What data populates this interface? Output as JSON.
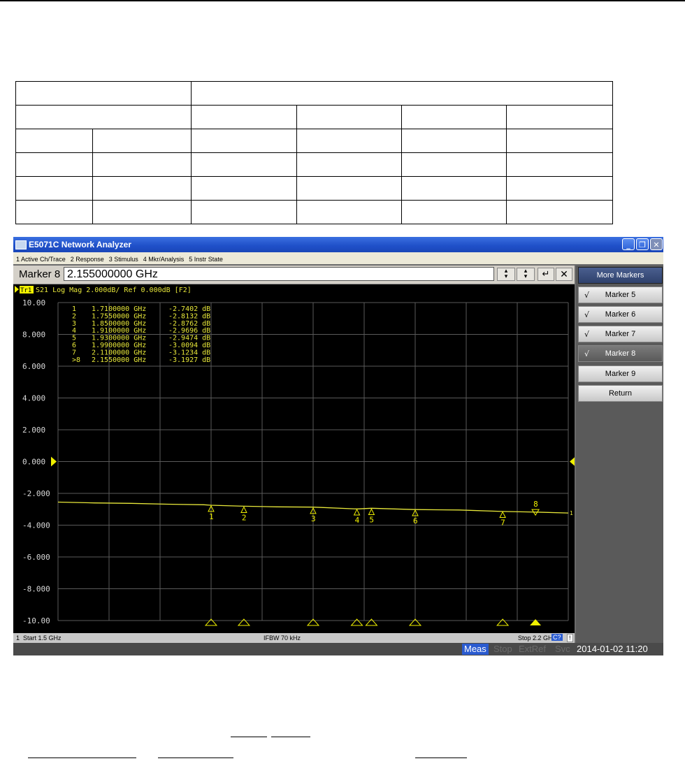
{
  "window": {
    "title": "E5071C Network Analyzer",
    "minimize_label": "_",
    "restore_label": "❐",
    "close_label": "✕"
  },
  "menu": [
    "1 Active Ch/Trace",
    "2 Response",
    "3 Stimulus",
    "4 Mkr/Analysis",
    "5 Instr State"
  ],
  "entry": {
    "label": "Marker 8",
    "value": "2.155000000 GHz"
  },
  "trace": {
    "header": "S21 Log Mag 2.000dB/ Ref 0.000dB [F2]",
    "tag": "Tr1",
    "ref_end_marker": "1"
  },
  "y_ticks": [
    "10.00",
    "8.000",
    "6.000",
    "4.000",
    "2.000",
    "0.000",
    "-2.000",
    "-4.000",
    "-6.000",
    "-8.000",
    "-10.00"
  ],
  "marker_table": [
    {
      "id": "1",
      "freq": "1.7100000 GHz",
      "val": "-2.7402 dB"
    },
    {
      "id": "2",
      "freq": "1.7550000 GHz",
      "val": "-2.8132 dB"
    },
    {
      "id": "3",
      "freq": "1.8500000 GHz",
      "val": "-2.8762 dB"
    },
    {
      "id": "4",
      "freq": "1.9100000 GHz",
      "val": "-2.9696 dB"
    },
    {
      "id": "5",
      "freq": "1.9300000 GHz",
      "val": "-2.9474 dB"
    },
    {
      "id": "6",
      "freq": "1.9900000 GHz",
      "val": "-3.0094 dB"
    },
    {
      "id": "7",
      "freq": "2.1100000 GHz",
      "val": "-3.1234 dB"
    },
    {
      "id": ">8",
      "freq": "2.1550000 GHz",
      "val": "-3.1927 dB"
    }
  ],
  "chart_data": {
    "type": "line",
    "x_unit": "GHz",
    "xlim": [
      1.5,
      2.2
    ],
    "ylim": [
      -10,
      10
    ],
    "y_div": 2,
    "grid": true,
    "series": [
      {
        "x": [
          1.5,
          1.55,
          1.6,
          1.65,
          1.7,
          1.71,
          1.755,
          1.8,
          1.85,
          1.91,
          1.93,
          1.99,
          2.05,
          2.11,
          2.155,
          2.2
        ],
        "y": [
          -2.55,
          -2.6,
          -2.63,
          -2.68,
          -2.72,
          -2.7402,
          -2.8132,
          -2.84,
          -2.8762,
          -2.9696,
          -2.9474,
          -3.0094,
          -3.06,
          -3.1234,
          -3.1927,
          -3.22
        ]
      }
    ],
    "markers": [
      {
        "label": "1",
        "x": 1.71,
        "y": -2.7402
      },
      {
        "label": "2",
        "x": 1.755,
        "y": -2.8132
      },
      {
        "label": "3",
        "x": 1.85,
        "y": -2.8762
      },
      {
        "label": "4",
        "x": 1.91,
        "y": -2.9696
      },
      {
        "label": "5",
        "x": 1.93,
        "y": -2.9474
      },
      {
        "label": "6",
        "x": 1.99,
        "y": -3.0094
      },
      {
        "label": "7",
        "x": 2.11,
        "y": -3.1234
      },
      {
        "label": "8",
        "x": 2.155,
        "y": -3.1927,
        "active": true
      }
    ]
  },
  "softkeys": [
    {
      "label": "More Markers",
      "checked": false,
      "style": "header"
    },
    {
      "label": "Marker 5",
      "checked": true
    },
    {
      "label": "Marker 6",
      "checked": true
    },
    {
      "label": "Marker 7",
      "checked": true
    },
    {
      "label": "Marker 8",
      "checked": true,
      "style": "selected"
    },
    {
      "label": "Marker 9",
      "checked": false
    },
    {
      "label": "Return",
      "checked": false
    }
  ],
  "status": {
    "channel": "1",
    "start": "Start 1.5 GHz",
    "ifbw": "IFBW 70 kHz",
    "stop": "Stop 2.2 GHz",
    "cal": "C?",
    "warn": "!"
  },
  "sysbar": {
    "meas": "Meas",
    "stop": "Stop",
    "extref": "ExtRef",
    "svc": "Svc",
    "datetime": "2014-01-02 11:20"
  },
  "colors": {
    "trace": "#e8e83a",
    "grid": "#5a5a5a",
    "scale_text": "#d8d8d8",
    "marker_yellow": "#f0f000"
  }
}
